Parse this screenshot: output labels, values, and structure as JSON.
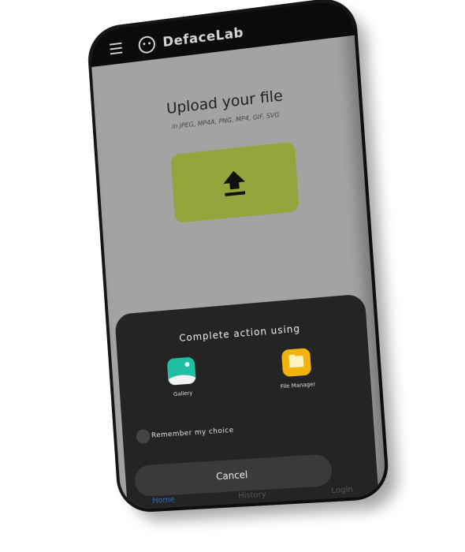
{
  "app": {
    "title": "DefaceLab",
    "menu_icon": "menu-icon",
    "logo_icon": "face-logo-icon"
  },
  "upload": {
    "title": "Upload your file",
    "formats": "in JPEG, MP4A, PNG, MP4, GIF, SVG",
    "icon": "upload-arrow-icon",
    "button_color": "#94a53d"
  },
  "sheet": {
    "title": "Complete action using",
    "apps": [
      {
        "label": "Gallery",
        "icon": "gallery-icon",
        "color": "#1fbfa4"
      },
      {
        "label": "File Manager",
        "icon": "folder-icon",
        "color": "#f2b30c"
      }
    ],
    "remember_label": "Remember my choice",
    "remember_checked": false,
    "cancel_label": "Cancel"
  },
  "nav": {
    "items": [
      "Home",
      "History",
      "Login"
    ],
    "active": "Home"
  }
}
